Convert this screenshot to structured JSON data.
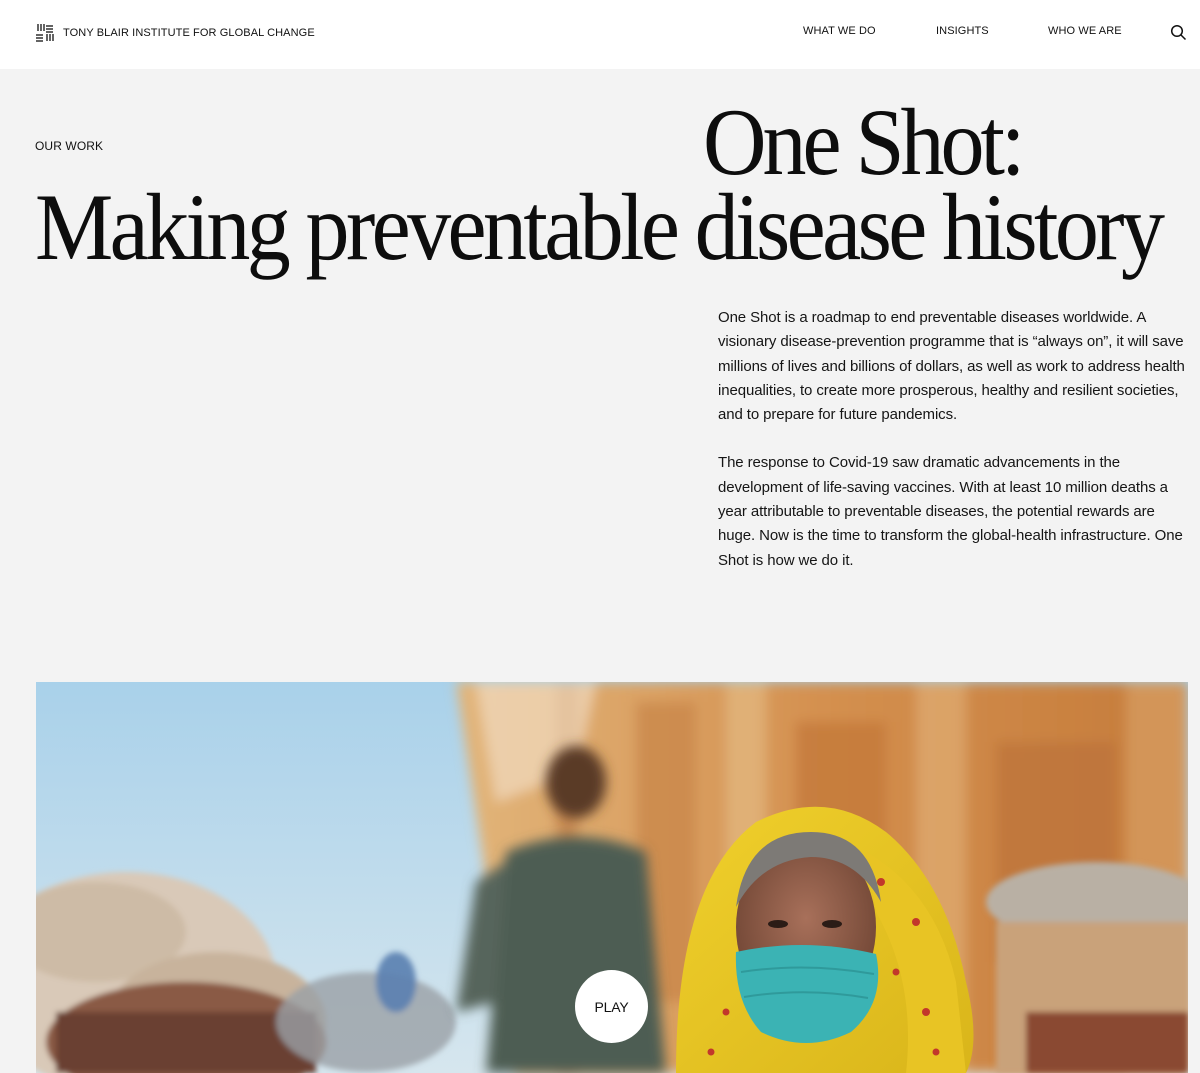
{
  "header": {
    "logo_icon": "institute-logo-icon",
    "org_name": "TONY BLAIR INSTITUTE FOR GLOBAL CHANGE",
    "nav": [
      "WHAT WE DO",
      "INSIGHTS",
      "WHO WE ARE"
    ],
    "search_icon": "search-icon"
  },
  "hero": {
    "eyebrow": "OUR WORK",
    "title_line1": "One Shot:",
    "title_line2": "Making preventable disease history",
    "paragraphs": [
      "One Shot is a roadmap to end preventable diseases worldwide. A visionary disease-prevention programme that is “always on”, it will save millions of lives and billions of dollars, as well as work to address health inequalities, to create more prosperous, healthy and resilient societies, and to prepare for future pandemics.",
      "The response to Covid-19 saw dramatic advancements in the development of life-saving vaccines. With at least 10 million deaths a year attributable to preventable diseases, the potential rewards are huge. Now is the time to transform the global-health infrastructure. One Shot is how we do it."
    ]
  },
  "video": {
    "play_label": "PLAY"
  },
  "colors": {
    "page_background": "#f3f3f3",
    "header_background": "#ffffff",
    "text": "#111111"
  }
}
